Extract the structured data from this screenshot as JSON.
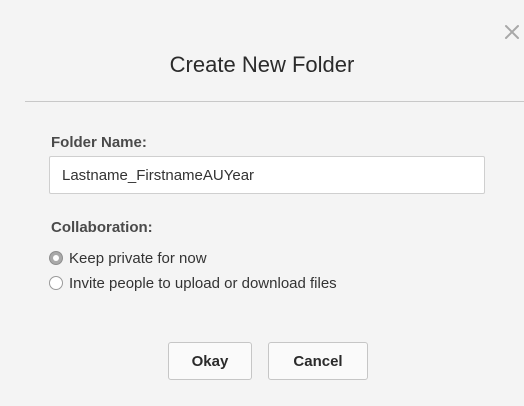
{
  "dialog": {
    "title": "Create New Folder",
    "close_icon": "close-icon"
  },
  "folder_name": {
    "label": "Folder Name:",
    "value": "Lastname_FirstnameAUYear"
  },
  "collaboration": {
    "label": "Collaboration:",
    "options": [
      {
        "label": "Keep private for now",
        "selected": true
      },
      {
        "label": "Invite people to upload or download files",
        "selected": false
      }
    ]
  },
  "buttons": {
    "okay_label": "Okay",
    "cancel_label": "Cancel"
  },
  "colors": {
    "background": "#f4f4f4",
    "text": "#2b2b2b",
    "divider": "#c8c8c8"
  }
}
